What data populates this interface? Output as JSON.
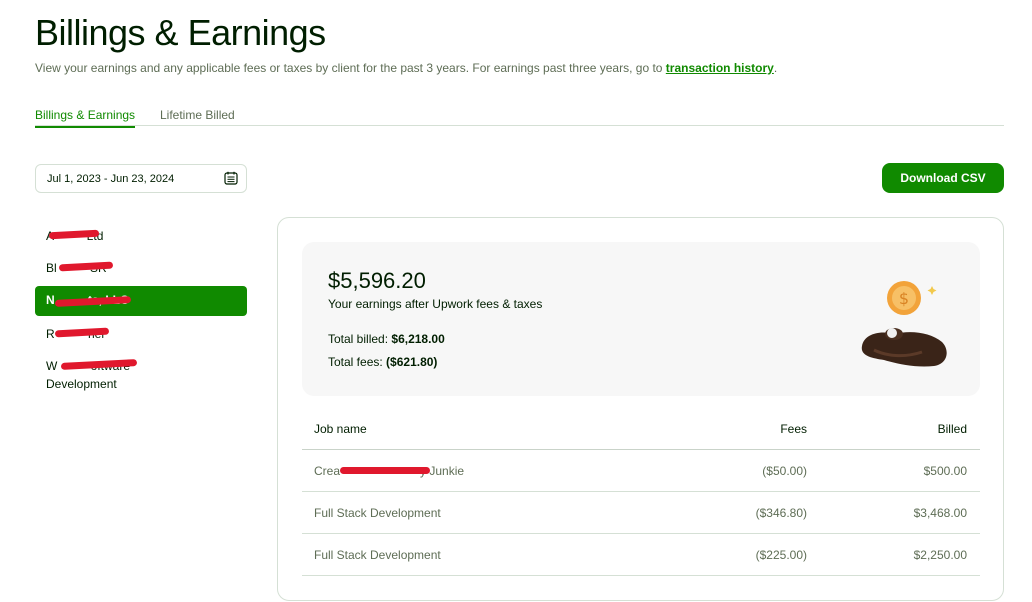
{
  "header": {
    "title": "Billings & Earnings",
    "subtitle_prefix": "View your earnings and any applicable fees or taxes by client for the past 3 years. For earnings past three years, go to ",
    "subtitle_link": "transaction history",
    "subtitle_suffix": "."
  },
  "tabs": [
    {
      "label": "Billings & Earnings",
      "active": true
    },
    {
      "label": "Lifetime Billed",
      "active": false
    }
  ],
  "date_range": {
    "value": "Jul 1, 2023 - Jun 23, 2024",
    "icon": "calendar-icon"
  },
  "download_button": {
    "label": "Download CSV"
  },
  "clients": [
    {
      "label": "A          Ltd",
      "active": false
    },
    {
      "label": "Bl          SR",
      "active": false
    },
    {
      "label": "N          ts, LLC",
      "active": true
    },
    {
      "label": "R          her",
      "active": false
    },
    {
      "label": "W          oftware Development",
      "active": false
    }
  ],
  "summary": {
    "amount": "$5,596.20",
    "amount_label": "Your earnings after Upwork fees & taxes",
    "total_billed_label": "Total billed:",
    "total_billed": "$6,218.00",
    "total_fees_label": "Total fees:",
    "total_fees": "($621.80)"
  },
  "table": {
    "headers": {
      "job": "Job name",
      "fees": "Fees",
      "billed": "Billed"
    },
    "rows": [
      {
        "job": "Crea                        y Junkie",
        "fees": "($50.00)",
        "billed": "$500.00"
      },
      {
        "job": "Full Stack Development",
        "fees": "($346.80)",
        "billed": "$3,468.00"
      },
      {
        "job": "Full Stack Development",
        "fees": "($225.00)",
        "billed": "$2,250.00"
      }
    ]
  },
  "colors": {
    "accent": "#108a00",
    "redaction": "#e0182d",
    "muted_text": "#5e6d55"
  }
}
